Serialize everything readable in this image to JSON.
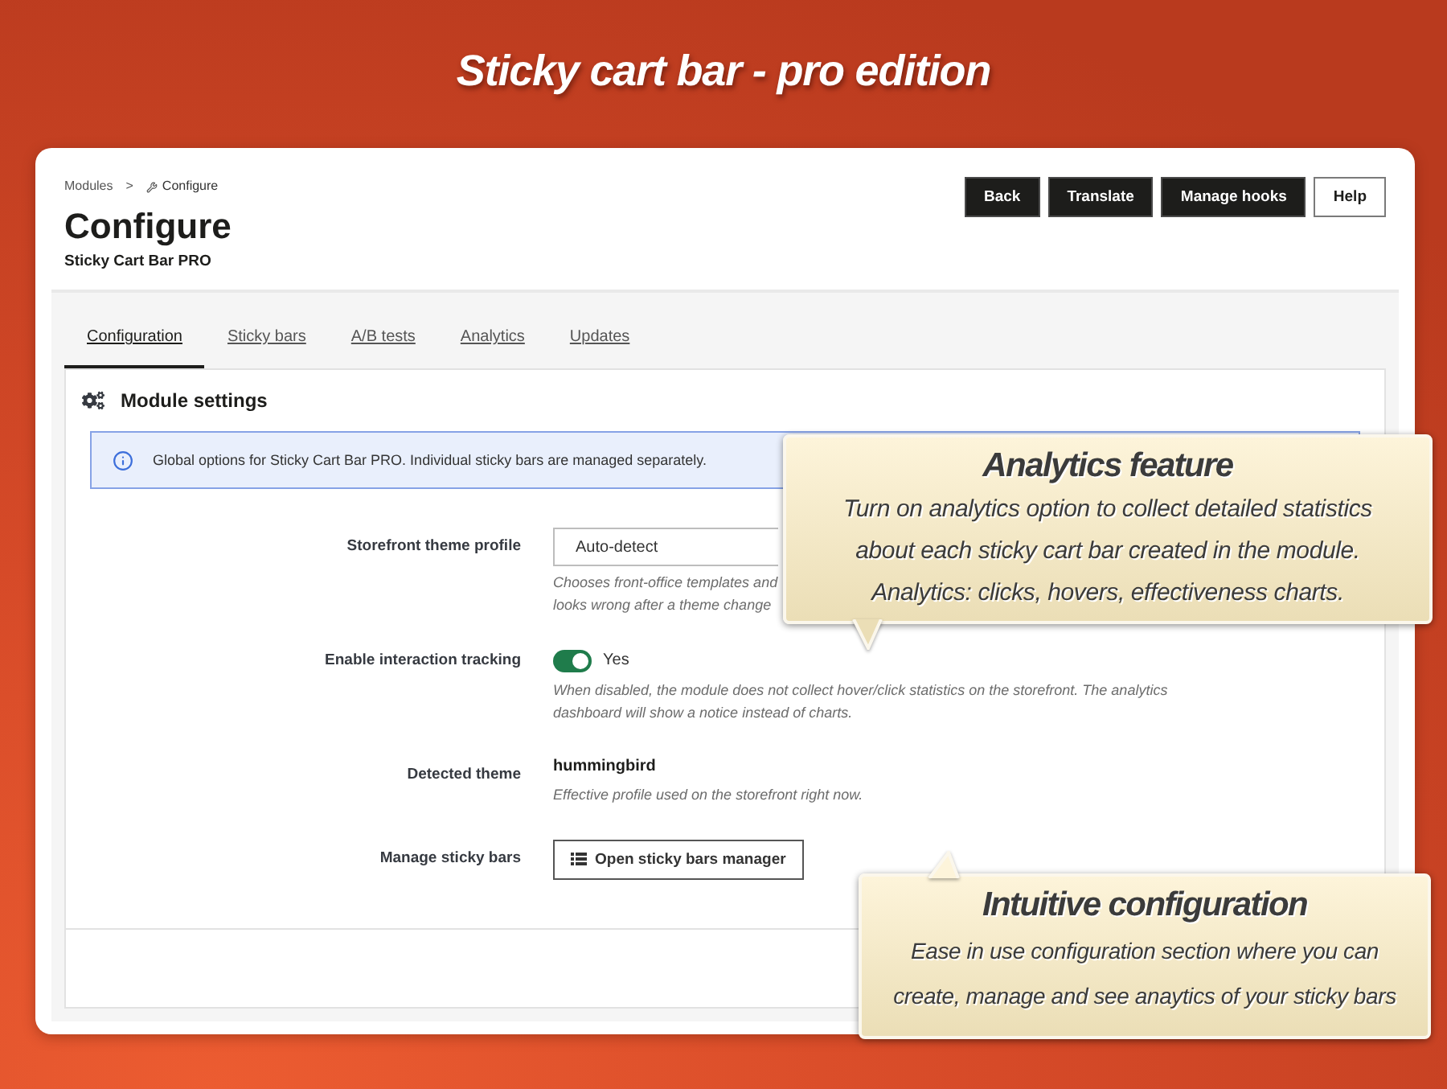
{
  "banner": {
    "title": "Sticky cart bar - pro edition"
  },
  "breadcrumb": {
    "items": [
      "Modules",
      "Configure"
    ],
    "separator": ">"
  },
  "page": {
    "title": "Configure",
    "subtitle": "Sticky Cart Bar PRO"
  },
  "toolbar": [
    {
      "label": "Back",
      "kind": "primary"
    },
    {
      "label": "Translate",
      "kind": "primary"
    },
    {
      "label": "Manage hooks",
      "kind": "primary"
    },
    {
      "label": "Help",
      "kind": "secondary"
    }
  ],
  "tabs": [
    {
      "label": "Configuration",
      "selected": true
    },
    {
      "label": "Sticky bars",
      "selected": false
    },
    {
      "label": "A/B tests",
      "selected": false
    },
    {
      "label": "Analytics",
      "selected": false
    },
    {
      "label": "Updates",
      "selected": false
    }
  ],
  "panel": {
    "title": "Module settings",
    "alert": "Global options for Sticky Cart Bar PRO. Individual sticky bars are managed separately.",
    "rows": [
      {
        "kind": "select",
        "label": "Storefront theme profile",
        "value": "Auto-detect",
        "help": [
          "Chooses front-office templates and",
          "looks wrong after a theme change"
        ]
      },
      {
        "kind": "toggle",
        "label": "Enable interaction tracking",
        "on": true,
        "state_label": "Yes",
        "help": [
          "When disabled, the module does not collect hover/click statistics on the storefront. The analytics dashboard will show a notice instead of charts."
        ]
      },
      {
        "kind": "text",
        "label": "Detected theme",
        "value": "hummingbird",
        "help": [
          "Effective profile used on the storefront right now."
        ]
      },
      {
        "kind": "button",
        "label": "Manage sticky bars",
        "button": "Open sticky bars manager"
      }
    ]
  },
  "callouts": [
    {
      "title": "Analytics feature",
      "text": "Turn on analytics option to collect detailed statistics about each sticky cart bar created in the module. Analytics: clicks, hovers, effectiveness charts."
    },
    {
      "title": "Intuitive configuration",
      "text": "Ease in use configuration section where you can create, manage and see anaytics of your sticky bars"
    }
  ]
}
